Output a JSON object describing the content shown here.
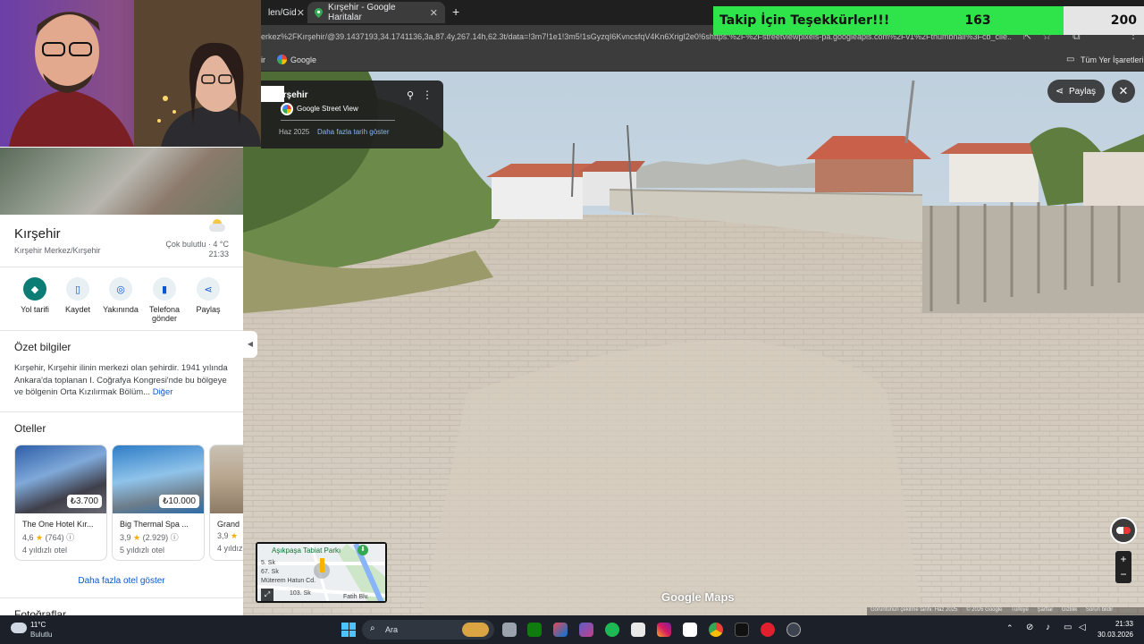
{
  "browser": {
    "tabs": [
      {
        "label": "len/Gid"
      },
      {
        "label": "Kırşehir - Google Haritalar",
        "active": true
      }
    ],
    "url": "erkez%2FKırşehir/@39.1437193,34.1741136,3a,87.4y,267.14h,62.3t/data=!3m7!1e1!3m5!1sGyzqI6KvncsfqV4Kn6XrigI2e0!6shttps:%2F%2Fstreetviewpixels-pa.googleapis.com%2Fv1%2Fthumbnail%3Fcb_clie...",
    "bookmarks": {
      "first": "ir",
      "google": "Google",
      "all": "Tüm Yer İşaretleri"
    }
  },
  "follow_bar": {
    "text": "Takip İçin Teşekkürler!!!",
    "current": "163",
    "goal": "200",
    "progress": 0.815,
    "color": "#2fe34a"
  },
  "streetview": {
    "place": "ırşehir",
    "source": "Google Street View",
    "date": "Haz 2025",
    "more_dates": "Daha fazla tarih göster",
    "share": "Paylaş",
    "minimap": {
      "park": "Aşıkpaşa Tabiat Parkı",
      "streets": [
        "5. Sk",
        "67. Sk",
        "Müterem Hatun Cd.",
        "103. Sk",
        "Fatih Blv."
      ]
    },
    "watermark": "Google Maps",
    "footer": {
      "capture": "Görüntünün çekilme tarihi: Haz 2025",
      "copyright": "© 2026 Google",
      "links": [
        "Türkiye",
        "Şartlar",
        "Gizlilik",
        "Sorun bildir"
      ]
    }
  },
  "panel": {
    "title": "Kırşehir",
    "subtitle": "Kırşehir Merkez/Kırşehir",
    "weather": {
      "condition": "Çok bulutlu",
      "temp": "4 °C",
      "time": "21:33"
    },
    "actions": [
      {
        "label": "Yol tarifi",
        "icon": "directions-icon"
      },
      {
        "label": "Kaydet",
        "icon": "bookmark-icon"
      },
      {
        "label": "Yakınında",
        "icon": "nearby-icon"
      },
      {
        "label": "Telefona gönder",
        "icon": "phone-icon"
      },
      {
        "label": "Paylaş",
        "icon": "share-icon"
      }
    ],
    "summary": {
      "heading": "Özet bilgiler",
      "text": "Kırşehir, Kırşehir ilinin merkezi olan şehirdir. 1941 yılında Ankara'da toplanan I. Coğrafya Kongresi'nde bu bölgeye ve bölgenin Orta Kızılırmak Bölüm...",
      "more": "Diğer"
    },
    "hotels": {
      "heading": "Oteller",
      "items": [
        {
          "name": "The One Hotel Kır...",
          "price": "₺3.700",
          "rating": "4,6",
          "reviews": "(764)",
          "class": "4 yıldızlı otel"
        },
        {
          "name": "Big Thermal Spa ...",
          "price": "₺10.000",
          "rating": "3,9",
          "reviews": "(2.929)",
          "class": "5 yıldızlı otel"
        },
        {
          "name": "Grand",
          "price": "",
          "rating": "3,9",
          "reviews": "",
          "class": "4 yıldız"
        }
      ],
      "more": "Daha fazla otel göster"
    },
    "photos_heading": "Fotoğraflar"
  },
  "taskbar": {
    "weather_temp": "11°C",
    "weather_text": "Bulutlu",
    "search": "Ara",
    "time": "21:33",
    "date": "30.03.2026"
  }
}
